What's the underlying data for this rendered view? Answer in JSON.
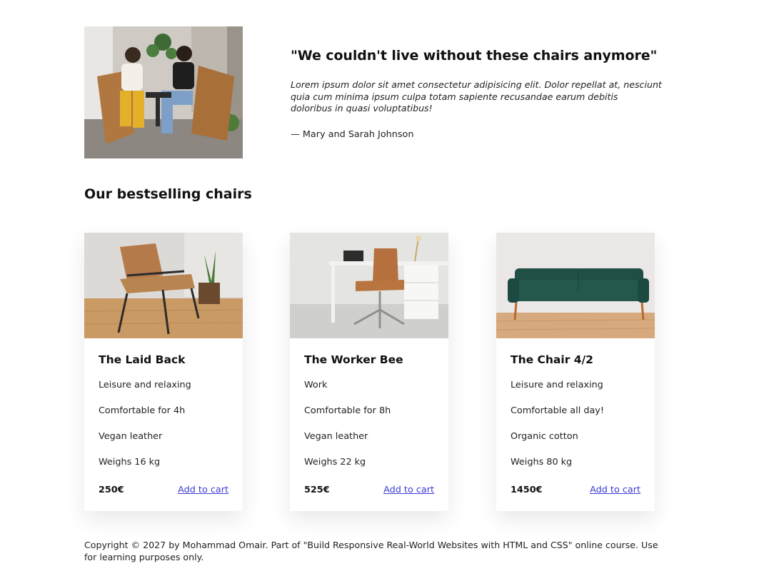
{
  "testimonial": {
    "photo_alt": "two-women-sitting-in-chairs",
    "title": "\"We couldn't live without these chairs anymore\"",
    "text": "Lorem ipsum dolor sit amet consectetur adipisicing elit. Dolor repellat at, nesciunt quia cum minima ipsum culpa totam sapiente recusandae earum debitis doloribus in quasi voluptatibus!",
    "author": "— Mary and Sarah Johnson"
  },
  "section_title": "Our bestselling chairs",
  "products": [
    {
      "name": "The Laid Back",
      "features": [
        "Leisure and relaxing",
        "Comfortable for 4h",
        "Vegan leather",
        "Weighs 16 kg"
      ],
      "price": "250€",
      "cta": "Add to cart"
    },
    {
      "name": "The Worker Bee",
      "features": [
        "Work",
        "Comfortable for 8h",
        "Vegan leather",
        "Weighs 22 kg"
      ],
      "price": "525€",
      "cta": "Add to cart"
    },
    {
      "name": "The Chair 4/2",
      "features": [
        "Leisure and relaxing",
        "Comfortable all day!",
        "Organic cotton",
        "Weighs 80 kg"
      ],
      "price": "1450€",
      "cta": "Add to cart"
    }
  ],
  "footer": {
    "copyright": "Copyright © 2027 by Mohammad Omair. Part of \"Build Responsive Real-World Websites with HTML and CSS\" online course. Use for learning purposes only."
  },
  "colors": {
    "link": "#3b3bd6",
    "text": "#222222",
    "heading": "#111111"
  }
}
